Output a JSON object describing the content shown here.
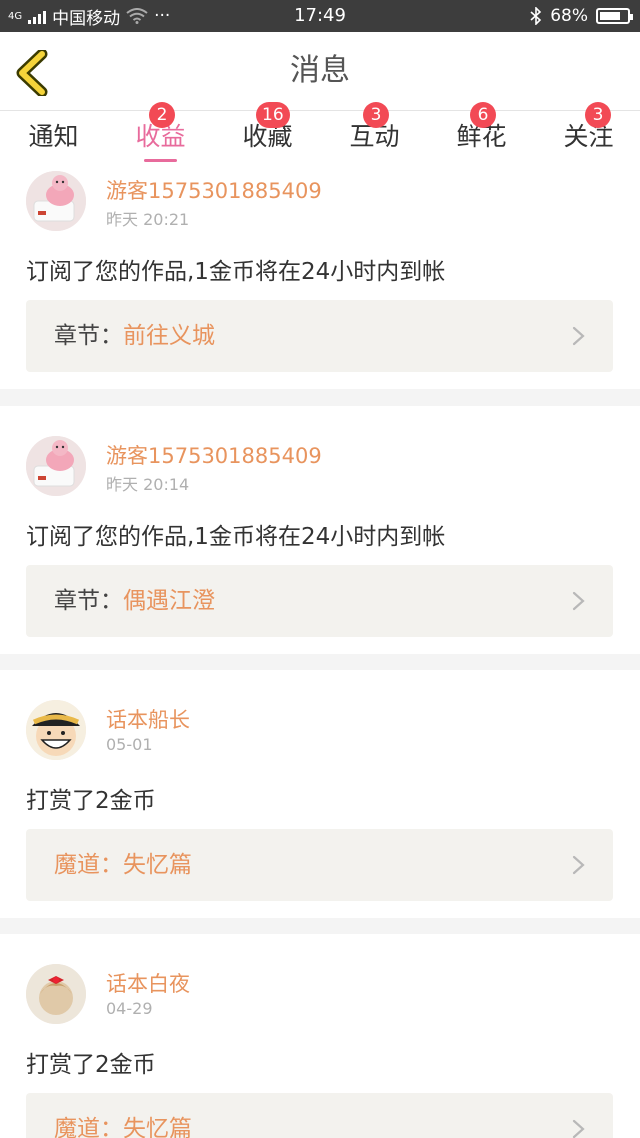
{
  "status_bar": {
    "network": "4G",
    "carrier": "中国移动",
    "dots": "···",
    "time": "17:49",
    "battery": "68%",
    "battery_level": 0.68
  },
  "header": {
    "title": "消息"
  },
  "tabs": [
    {
      "label": "通知",
      "badge": ""
    },
    {
      "label": "收益",
      "badge": "2"
    },
    {
      "label": "收藏",
      "badge": "16"
    },
    {
      "label": "互动",
      "badge": "3"
    },
    {
      "label": "鲜花",
      "badge": "6"
    },
    {
      "label": "关注",
      "badge": "3"
    }
  ],
  "active_tab": "收益",
  "colors": {
    "accent_pink": "#e86b9c",
    "accent_orange": "#e8945e",
    "badge_red": "#f24a55"
  },
  "messages": [
    {
      "username": "游客1575301885409",
      "time": "昨天 20:21",
      "text": "订阅了您的作品,1金币将在24小时内到帐",
      "chapter_label": "章节：",
      "chapter_name": "前往义城",
      "avatar": "piggy-scale-avatar"
    },
    {
      "username": "游客1575301885409",
      "time": "昨天 20:14",
      "text": "订阅了您的作品,1金币将在24小时内到帐",
      "chapter_label": "章节：",
      "chapter_name": "偶遇江澄",
      "avatar": "piggy-scale-avatar"
    },
    {
      "username": "话本船长",
      "time": "05-01",
      "text": "打赏了2金币",
      "chapter_label": "魔道：",
      "chapter_name": "失忆篇",
      "avatar": "straw-hat-avatar"
    },
    {
      "username": "话本白夜",
      "time": "04-29",
      "text": "打赏了2金币",
      "chapter_label": "魔道：",
      "chapter_name": "失忆篇",
      "avatar": "girl-with-bow-avatar"
    }
  ]
}
